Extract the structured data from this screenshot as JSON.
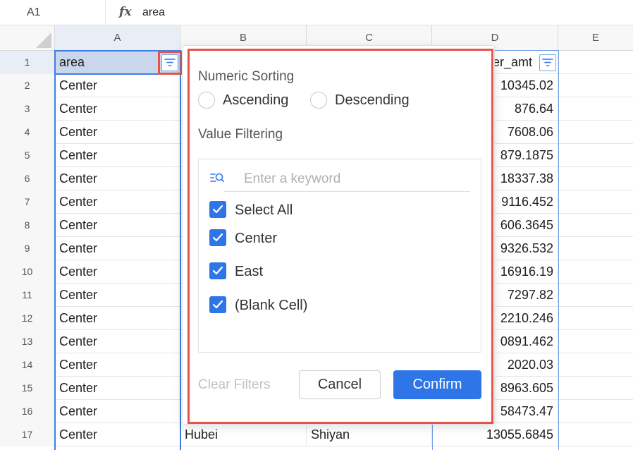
{
  "formula_bar": {
    "cell_ref": "A1",
    "fx_label": "fx",
    "value": "area"
  },
  "columns": [
    "A",
    "B",
    "C",
    "D",
    "E"
  ],
  "header_row": {
    "row_num": "1",
    "area": "area",
    "d_header_partial": "er_amt"
  },
  "rows": [
    {
      "num": "2",
      "a": "Center",
      "d": "10345.02"
    },
    {
      "num": "3",
      "a": "Center",
      "d": "876.64"
    },
    {
      "num": "4",
      "a": "Center",
      "d": "7608.06"
    },
    {
      "num": "5",
      "a": "Center",
      "d": "879.1875"
    },
    {
      "num": "6",
      "a": "Center",
      "d": "18337.38"
    },
    {
      "num": "7",
      "a": "Center",
      "d": "9116.452"
    },
    {
      "num": "8",
      "a": "Center",
      "d": "606.3645"
    },
    {
      "num": "9",
      "a": "Center",
      "d": "9326.532"
    },
    {
      "num": "10",
      "a": "Center",
      "d": "16916.19"
    },
    {
      "num": "11",
      "a": "Center",
      "d": "7297.82"
    },
    {
      "num": "12",
      "a": "Center",
      "d": "2210.246"
    },
    {
      "num": "13",
      "a": "Center",
      "d": "0891.462"
    },
    {
      "num": "14",
      "a": "Center",
      "d": "2020.03"
    },
    {
      "num": "15",
      "a": "Center",
      "d": "8963.605"
    },
    {
      "num": "16",
      "a": "Center",
      "d": "58473.47"
    },
    {
      "num": "17",
      "a": "Center",
      "b": "Hubei",
      "c": "Shiyan",
      "d": "13055.6845"
    }
  ],
  "filter_popup": {
    "sorting_title": "Numeric Sorting",
    "ascending": "Ascending",
    "descending": "Descending",
    "filtering_title": "Value Filtering",
    "search_placeholder": "Enter a keyword",
    "items": [
      "Select All",
      "Center",
      "East",
      "(Blank Cell)"
    ],
    "clear_label": "Clear Filters",
    "cancel_label": "Cancel",
    "confirm_label": "Confirm"
  },
  "colors": {
    "accent": "#2e75e8",
    "highlight_outline": "#e5534b",
    "selected_header": "#c9d6ec"
  }
}
